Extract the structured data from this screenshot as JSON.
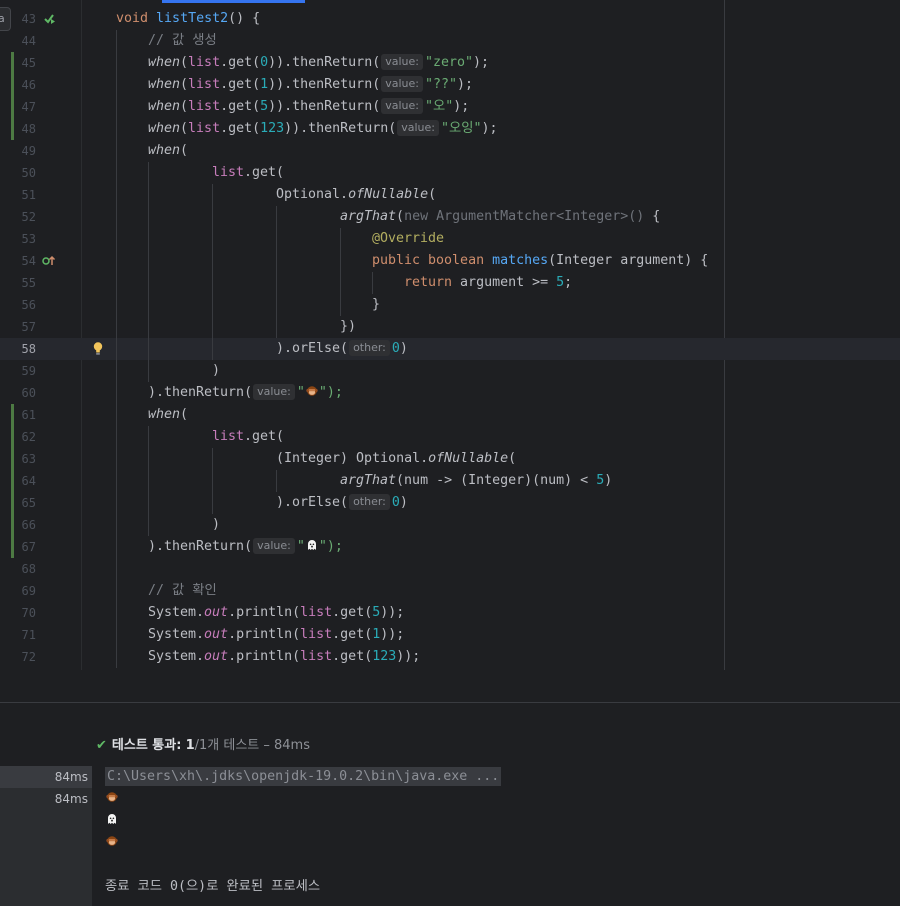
{
  "editor": {
    "left_tab_letter": "a",
    "lines": {
      "l43": {
        "num": "43",
        "kw": "void",
        "name": "listTest2",
        "rest": "() {"
      },
      "l44": {
        "num": "44",
        "comment": "// 값 생성"
      },
      "l45": {
        "num": "45",
        "when": "when",
        "list": "list",
        "get": ".get(",
        "arg": "0",
        "mid": ")).thenReturn(",
        "hint": "value:",
        "str": "\"zero\"",
        "end": ");"
      },
      "l46": {
        "num": "46",
        "when": "when",
        "list": "list",
        "get": ".get(",
        "arg": "1",
        "mid": ")).thenReturn(",
        "hint": "value:",
        "str": "\"??\"",
        "end": ");"
      },
      "l47": {
        "num": "47",
        "when": "when",
        "list": "list",
        "get": ".get(",
        "arg": "5",
        "mid": ")).thenReturn(",
        "hint": "value:",
        "str": "\"오\"",
        "end": ");"
      },
      "l48": {
        "num": "48",
        "when": "when",
        "list": "list",
        "get": ".get(",
        "arg": "123",
        "mid": ")).thenReturn(",
        "hint": "value:",
        "str": "\"오잉\"",
        "end": ");"
      },
      "l49": {
        "num": "49",
        "when": "when",
        "rest": "("
      },
      "l50": {
        "num": "50",
        "list": "list",
        "rest": ".get("
      },
      "l51": {
        "num": "51",
        "cls": "Optional.",
        "method": "ofNullable",
        "rest": "("
      },
      "l52": {
        "num": "52",
        "method": "argThat",
        "open": "(",
        "dim": "new ArgumentMatcher<Integer>()",
        "rest": " {"
      },
      "l53": {
        "num": "53",
        "ann": "@Override"
      },
      "l54": {
        "num": "54",
        "kw": "public boolean",
        "name": "matches",
        "rest": "(Integer argument) {"
      },
      "l55": {
        "num": "55",
        "kw": "return",
        "rest": " argument >= ",
        "arg": "5",
        "end": ";"
      },
      "l56": {
        "num": "56",
        "rest": "}"
      },
      "l57": {
        "num": "57",
        "rest": "})"
      },
      "l58": {
        "num": "58",
        "rest": ").orElse(",
        "hint": "other:",
        "arg": "0",
        "end": ")"
      },
      "l59": {
        "num": "59",
        "rest": ")"
      },
      "l60": {
        "num": "60",
        "rest": ").thenReturn(",
        "hint": "value:",
        "q1": "\"",
        "q2": "\");"
      },
      "l61": {
        "num": "61",
        "when": "when",
        "rest": "("
      },
      "l62": {
        "num": "62",
        "list": "list",
        "rest": ".get("
      },
      "l63": {
        "num": "63",
        "pre": "(Integer) Optional.",
        "method": "ofNullable",
        "rest": "("
      },
      "l64": {
        "num": "64",
        "method": "argThat",
        "rest": "(num -> (Integer)(num) < ",
        "arg": "5",
        "end": ")"
      },
      "l65": {
        "num": "65",
        "rest": ").orElse(",
        "hint": "other:",
        "arg": "0",
        "end": ")"
      },
      "l66": {
        "num": "66",
        "rest": ")"
      },
      "l67": {
        "num": "67",
        "rest": ").thenReturn(",
        "hint": "value:",
        "q1": "\"",
        "q2": "\");"
      },
      "l68": {
        "num": "68"
      },
      "l69": {
        "num": "69",
        "comment": "// 값 확인"
      },
      "l70": {
        "num": "70",
        "sys": "System.",
        "out": "out",
        "mid": ".println(",
        "list": "list",
        "get": ".get(",
        "arg": "5",
        "end": "));"
      },
      "l71": {
        "num": "71",
        "sys": "System.",
        "out": "out",
        "mid": ".println(",
        "list": "list",
        "get": ".get(",
        "arg": "1",
        "end": "));"
      },
      "l72": {
        "num": "72",
        "sys": "System.",
        "out": "out",
        "mid": ".println(",
        "list": "list",
        "get": ".get(",
        "arg": "123",
        "end": "));"
      }
    }
  },
  "test_results": {
    "status_label": "테스트 통과:",
    "passed": "1",
    "summary": "/1개 테스트 – 84ms",
    "tree": [
      {
        "time": "84ms"
      },
      {
        "time": "84ms"
      }
    ]
  },
  "console": {
    "command": "C:\\Users\\xh\\.jdks\\openjdk-19.0.2\\bin\\java.exe ...",
    "exit_message": "종료 코드 0(으)로 완료된 프로세스"
  },
  "icons": [
    "run-test-icon",
    "override-icon",
    "lightbulb-icon",
    "monkey-emoji-icon",
    "ghost-emoji-icon",
    "check-icon"
  ],
  "colors": {
    "background": "#1e1f22",
    "keyword": "#cf8e6d",
    "function": "#56a8f5",
    "string": "#6aab73",
    "number": "#2aacb8",
    "field": "#c77dbb",
    "annotation": "#b3ae60",
    "pass": "#5fb865"
  }
}
